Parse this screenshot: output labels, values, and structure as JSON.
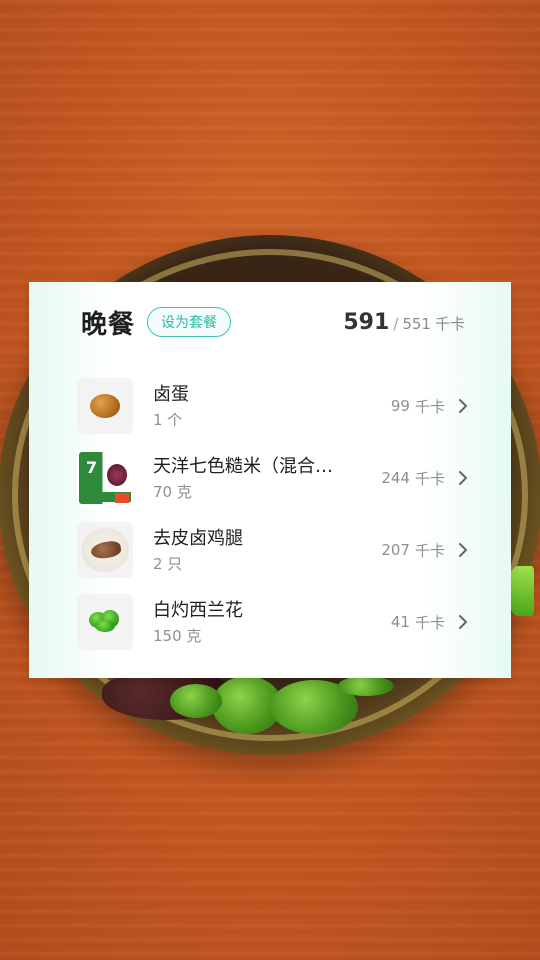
{
  "meal": {
    "title": "晚餐",
    "set_combo_label": "设为套餐",
    "total_eaten": "591",
    "separator": "/",
    "total_goal": "551",
    "unit": "千卡"
  },
  "foods": [
    {
      "name": "卤蛋",
      "amount": "1 个",
      "kcal": "99",
      "unit": "千卡",
      "icon": "braised-egg-photo"
    },
    {
      "name": "天洋七色糙米（混合…",
      "amount": "70 克",
      "kcal": "244",
      "unit": "千卡",
      "icon": "brown-rice-package-photo"
    },
    {
      "name": "去皮卤鸡腿",
      "amount": "2 只",
      "kcal": "207",
      "unit": "千卡",
      "icon": "chicken-drumstick-photo"
    },
    {
      "name": "白灼西兰花",
      "amount": "150 克",
      "kcal": "41",
      "unit": "千卡",
      "icon": "broccoli-photo"
    }
  ],
  "colors": {
    "accent": "#38c6b3",
    "background": "#c85a22"
  }
}
